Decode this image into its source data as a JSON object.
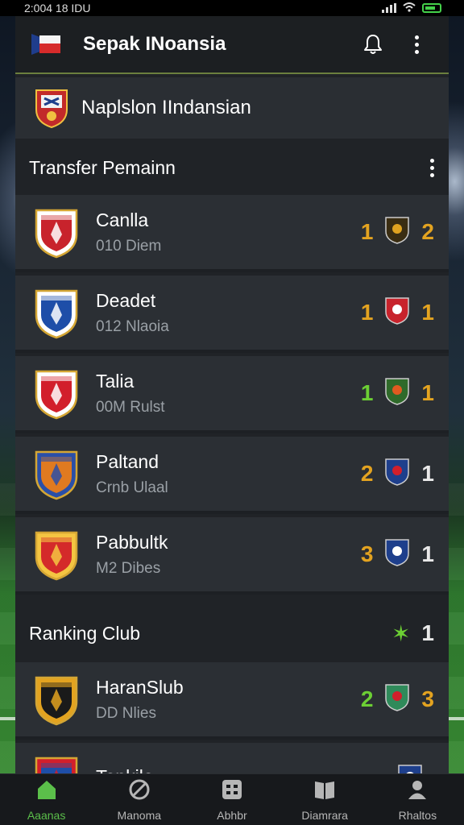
{
  "status": {
    "time": "2:004 18 IDU"
  },
  "app": {
    "title": "Sepak INoansia"
  },
  "league": {
    "name": "Naplslon IIndansian"
  },
  "transfers": {
    "heading": "Transfer Pemainn",
    "items": [
      {
        "name": "Canlla",
        "sub": "010 Diem",
        "left": "1",
        "right": "2",
        "left_color": "#e3a320",
        "right_color": "#e3a320",
        "crest_colors": [
          "#c8232c",
          "#ffffff"
        ],
        "mini_colors": [
          "#3a2d12",
          "#e0a320"
        ]
      },
      {
        "name": "Deadet",
        "sub": "012 Nlaoia",
        "left": "1",
        "right": "1",
        "left_color": "#e3a320",
        "right_color": "#e3a320",
        "crest_colors": [
          "#1e4ea8",
          "#ffffff"
        ],
        "mini_colors": [
          "#c8232c",
          "#ffffff"
        ]
      },
      {
        "name": "Talia",
        "sub": "00M Rulst",
        "left": "1",
        "right": "1",
        "left_color": "#6ccf34",
        "right_color": "#e3a320",
        "crest_colors": [
          "#d21f2b",
          "#ffffff"
        ],
        "mini_colors": [
          "#2f6a2a",
          "#e05a20"
        ]
      },
      {
        "name": "Paltand",
        "sub": "Crnb Ulaal",
        "left": "2",
        "right": "1",
        "left_color": "#e3a320",
        "right_color": "#e9e9e9",
        "crest_colors": [
          "#e07a20",
          "#2a4fa8"
        ],
        "mini_colors": [
          "#1e3f8c",
          "#d21f2b"
        ]
      },
      {
        "name": "Pabbultk",
        "sub": "M2 Dibes",
        "left": "3",
        "right": "1",
        "left_color": "#e3a320",
        "right_color": "#e9e9e9",
        "crest_colors": [
          "#d42a2a",
          "#f4c542"
        ],
        "mini_colors": [
          "#1e3f8c",
          "#ffffff"
        ]
      }
    ]
  },
  "ranking": {
    "heading": "Ranking Club",
    "head_score": "1",
    "items": [
      {
        "name": "HaranSlub",
        "sub": "DD Nlies",
        "left": "2",
        "right": "3",
        "left_color": "#6ccf34",
        "right_color": "#e3a320",
        "crest_colors": [
          "#1a1a1a",
          "#e3a320"
        ],
        "mini_colors": [
          "#2f8a5a",
          "#d21f2b"
        ]
      },
      {
        "name": "Tenkile",
        "sub": "",
        "left": "",
        "right": "",
        "left_color": "#e3a320",
        "right_color": "#e3a320",
        "crest_colors": [
          "#1e4ea8",
          "#d21f2b"
        ],
        "mini_colors": [
          "#1e3f8c",
          "#ffffff"
        ]
      }
    ]
  },
  "nav": [
    {
      "label": "Aaanas",
      "icon": "home-icon"
    },
    {
      "label": "Manoma",
      "icon": "compass-icon"
    },
    {
      "label": "Abhbr",
      "icon": "grid-icon"
    },
    {
      "label": "Diamrara",
      "icon": "book-icon"
    },
    {
      "label": "Rhaltos",
      "icon": "profile-icon"
    }
  ],
  "colors": {
    "accent": "#5bbf4a",
    "amber": "#e3a320",
    "panel": "#202327"
  }
}
